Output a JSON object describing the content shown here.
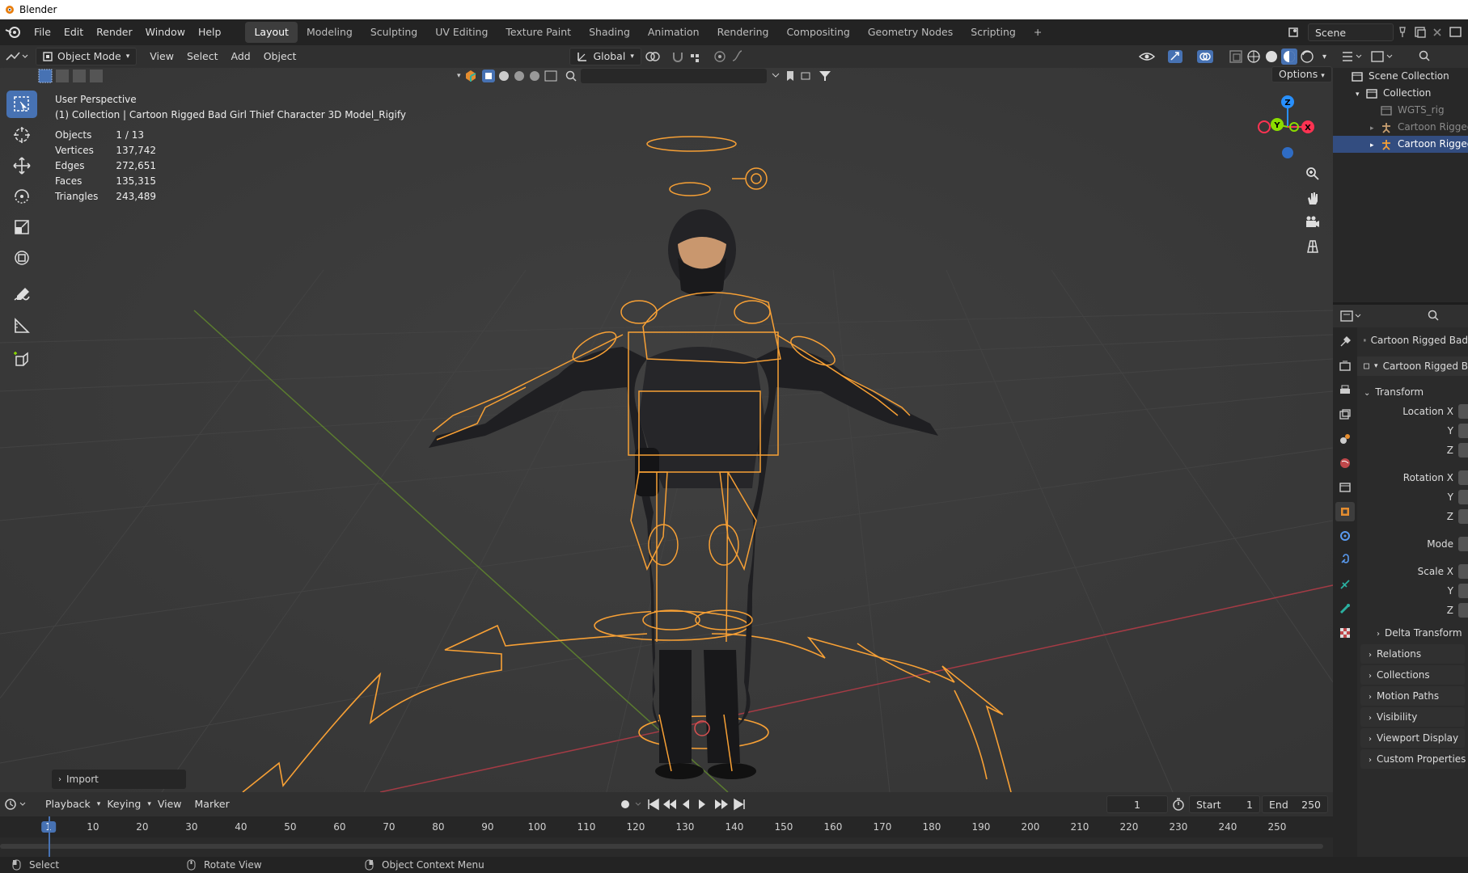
{
  "window": {
    "title": "Blender"
  },
  "menus": [
    "File",
    "Edit",
    "Render",
    "Window",
    "Help"
  ],
  "workspaces": [
    "Layout",
    "Modeling",
    "Sculpting",
    "UV Editing",
    "Texture Paint",
    "Shading",
    "Animation",
    "Rendering",
    "Compositing",
    "Geometry Nodes",
    "Scripting",
    "+"
  ],
  "active_workspace": "Layout",
  "scene": {
    "name": "Scene"
  },
  "viewport_header": {
    "mode": "Object Mode",
    "menus": [
      "View",
      "Select",
      "Add",
      "Object"
    ],
    "orientation": "Global",
    "options_label": "Options"
  },
  "overlay": {
    "view_name": "User Perspective",
    "collection_line": "(1) Collection | Cartoon Rigged Bad Girl Thief Character 3D Model_Rigify",
    "stats": [
      {
        "label": "Objects",
        "value": "1 / 13"
      },
      {
        "label": "Vertices",
        "value": "137,742"
      },
      {
        "label": "Edges",
        "value": "272,651"
      },
      {
        "label": "Faces",
        "value": "135,315"
      },
      {
        "label": "Triangles",
        "value": "243,489"
      }
    ]
  },
  "gizmo": {
    "x": "X",
    "y": "Y",
    "z": "Z"
  },
  "import_panel": "Import",
  "timeline": {
    "menus": [
      "Playback",
      "Keying",
      "View",
      "Marker"
    ],
    "current_frame": "1",
    "start_label": "Start",
    "start": "1",
    "end_label": "End",
    "end": "250",
    "ticks": [
      "1",
      "10",
      "20",
      "30",
      "40",
      "50",
      "60",
      "70",
      "80",
      "90",
      "100",
      "110",
      "120",
      "130",
      "140",
      "150",
      "160",
      "170",
      "180",
      "190",
      "200",
      "210",
      "220",
      "230",
      "240",
      "250"
    ]
  },
  "statusbar": {
    "items": [
      "Select",
      "Rotate View",
      "Object Context Menu"
    ]
  },
  "outliner": {
    "rows": [
      {
        "label": "Scene Collection",
        "indent": 0,
        "selected": false,
        "dim": false
      },
      {
        "label": "Collection",
        "indent": 1,
        "selected": false,
        "dim": false
      },
      {
        "label": "WGTS_rig",
        "indent": 2,
        "selected": false,
        "dim": true
      },
      {
        "label": "Cartoon Rigged",
        "indent": 2,
        "selected": false,
        "dim": true
      },
      {
        "label": "Cartoon Rigged",
        "indent": 2,
        "selected": true,
        "dim": false
      }
    ]
  },
  "properties": {
    "object_name": "Cartoon Rigged Bad",
    "datablock": "Cartoon Rigged B",
    "transform_label": "Transform",
    "rows": [
      {
        "label": "Location X"
      },
      {
        "label": "Y"
      },
      {
        "label": "Z"
      },
      {
        "label": "Rotation X"
      },
      {
        "label": "Y"
      },
      {
        "label": "Z"
      },
      {
        "label": "Mode"
      },
      {
        "label": "Scale X"
      },
      {
        "label": "Y"
      },
      {
        "label": "Z"
      }
    ],
    "delta_transform": "Delta Transform",
    "sections": [
      "Relations",
      "Collections",
      "Motion Paths",
      "Visibility",
      "Viewport Display",
      "Custom Properties"
    ]
  },
  "colors": {
    "accent": "#4772b3",
    "selection": "#f7a035",
    "x_axis": "#ff3352",
    "y_axis": "#8bdc00",
    "z_axis": "#2890ff"
  }
}
